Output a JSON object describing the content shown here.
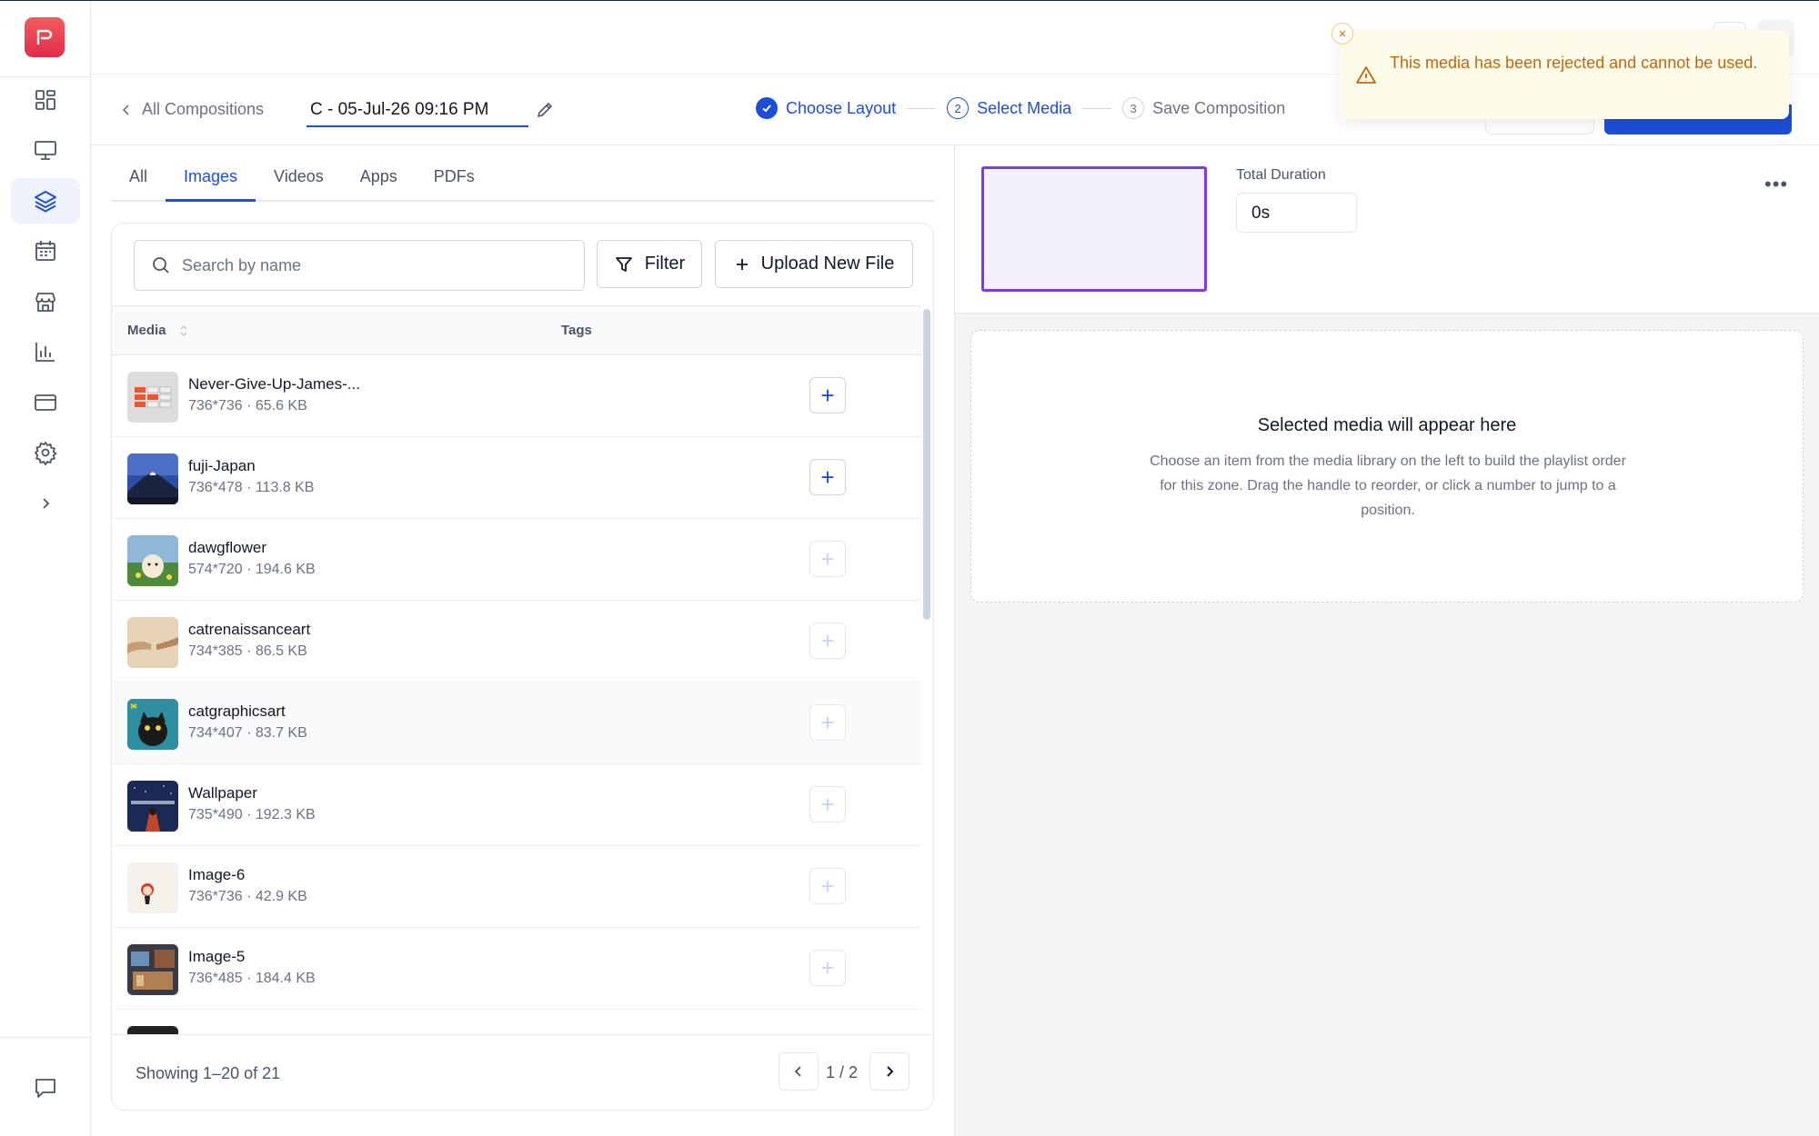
{
  "app": {
    "logo_letter": "P",
    "brand_color": "#e8374f",
    "accent_color": "#1d4ed8"
  },
  "sidebar": {
    "items": [
      {
        "name": "dashboard",
        "icon": "grid-icon",
        "active": false
      },
      {
        "name": "screens",
        "icon": "monitor-icon",
        "active": false
      },
      {
        "name": "compositions",
        "icon": "layers-icon",
        "active": true
      },
      {
        "name": "schedule",
        "icon": "calendar-icon",
        "active": false
      },
      {
        "name": "store",
        "icon": "store-icon",
        "active": false
      },
      {
        "name": "analytics",
        "icon": "bar-chart-icon",
        "active": false
      },
      {
        "name": "billing",
        "icon": "credit-card-icon",
        "active": false
      },
      {
        "name": "settings",
        "icon": "gear-icon",
        "active": false
      },
      {
        "name": "expand",
        "icon": "chevron-right-icon",
        "active": false
      }
    ],
    "bottom_icon": "chat-icon"
  },
  "header": {
    "back_label": "All Compositions",
    "composition_name": "C - 05-Jul-26 09:16 PM",
    "steps": [
      {
        "number": "1",
        "label": "Choose Layout",
        "state": "done"
      },
      {
        "number": "2",
        "label": "Select Media",
        "state": "current"
      },
      {
        "number": "3",
        "label": "Save Composition",
        "state": "todo"
      }
    ]
  },
  "toast": {
    "message": "This media has been rejected and cannot be used.",
    "type": "warning",
    "color": "#c2680c"
  },
  "library": {
    "tabs": [
      {
        "label": "All",
        "active": false
      },
      {
        "label": "Images",
        "active": true
      },
      {
        "label": "Videos",
        "active": false
      },
      {
        "label": "Apps",
        "active": false
      },
      {
        "label": "PDFs",
        "active": false
      }
    ],
    "search_placeholder": "Search by name",
    "filter_label": "Filter",
    "upload_label": "Upload New File",
    "columns": {
      "media": "Media",
      "tags": "Tags"
    },
    "rows": [
      {
        "name": "Never-Give-Up-James-...",
        "meta": "736*736 · 65.6 KB",
        "enabled": true
      },
      {
        "name": "fuji-Japan",
        "meta": "736*478 · 113.8 KB",
        "enabled": true
      },
      {
        "name": "dawgflower",
        "meta": "574*720 · 194.6 KB",
        "enabled": false
      },
      {
        "name": "catrenaissanceart",
        "meta": "734*385 · 86.5 KB",
        "enabled": false
      },
      {
        "name": "catgraphicsart",
        "meta": "734*407 · 83.7 KB",
        "enabled": false
      },
      {
        "name": "Wallpaper",
        "meta": "735*490 · 192.3 KB",
        "enabled": false
      },
      {
        "name": "Image-6",
        "meta": "736*736 · 42.9 KB",
        "enabled": false
      },
      {
        "name": "Image-5",
        "meta": "736*485 · 184.4 KB",
        "enabled": false
      }
    ],
    "showing": "Showing 1–20 of 21",
    "page": "1 / 2"
  },
  "zone": {
    "duration_label": "Total Duration",
    "duration_value": "0s",
    "zone_color": "#7c3aed",
    "empty_title": "Selected media will appear here",
    "empty_desc": "Choose an item from the media library on the left to build the playlist order for this zone. Drag the handle to reorder, or click a number to jump to a position."
  }
}
